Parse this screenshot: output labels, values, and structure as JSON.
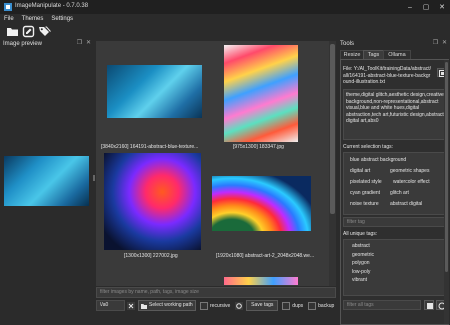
{
  "window": {
    "title": "ImageManipulate - 0.7.0.38"
  },
  "menu": [
    "File",
    "Themes",
    "Settings"
  ],
  "toolbar": {
    "icons": [
      "folder-icon",
      "edit-icon",
      "tags-icon"
    ]
  },
  "left_panel": {
    "title": "Image preview"
  },
  "gallery": {
    "items": [
      {
        "caption": "[3840x2160] 164191-abstract-blue-texture..."
      },
      {
        "caption": "[975x1300] 183347.jpg"
      },
      {
        "caption": "[1300x1300] 227002.jpg"
      },
      {
        "caption": "[1920x1080] abstract-art-2_2048x2048.we..."
      }
    ],
    "filter_placeholder": "filter images by name, path, tags, image size"
  },
  "bottom_bar": {
    "path": "\\/a0",
    "select_path_label": "Select working path",
    "recursive_label": "recursive",
    "save_tags_label": "Save tags",
    "dups_label": "dups",
    "backup_label": "backup"
  },
  "tools": {
    "title": "Tools",
    "tabs": [
      "Resize",
      "Tags",
      "Ollama"
    ],
    "active_tab": "Tags",
    "file_path": "File: Y:/AI_ToolKit/trainingData/abstract/all/164191-abstract-blue-texture-background-illustration.txt",
    "tags_text": "theme,digital glitch,aesthetic design,creative background,non-representational,abstract visual,blue and white hues,digital abstraction,tech art,futuristic design,abstract digital art,abs0",
    "current_tags_label": "Current selection tags:",
    "current_tags": [
      [
        "blue abstract background"
      ],
      [
        "digital art",
        "geometric shapes"
      ],
      [
        "pixelated style",
        "watercolor effect"
      ],
      [
        "cyan gradient",
        "glitch art"
      ],
      [
        "noise texture",
        "abstract digital"
      ]
    ],
    "filter_tag_placeholder": "filter tag",
    "all_tags_label": "All unique tags:",
    "all_tags": [
      "abstract",
      "geometric",
      "polygon",
      "low-poly",
      "vibrant"
    ],
    "filter_all_tags_placeholder": "filter all tags"
  },
  "colors": {
    "accent": "#0078d7",
    "bg": "#2b2b2b",
    "panel": "#3a3a3a"
  }
}
